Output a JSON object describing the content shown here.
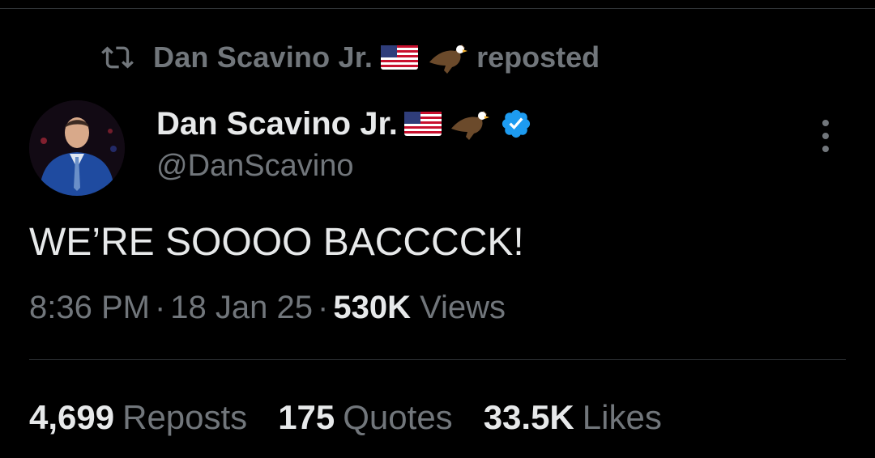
{
  "repost_banner": {
    "reposter_name": "Dan Scavino Jr.",
    "action": "reposted",
    "icon": "repost-icon"
  },
  "author": {
    "display_name": "Dan Scavino Jr.",
    "handle": "@DanScavino",
    "verified": true,
    "emoji": [
      "us-flag-icon",
      "eagle-icon"
    ]
  },
  "tweet": {
    "text": "WE’RE SOOOO BACCCCK!",
    "time": "8:36 PM",
    "date": "18 Jan 25",
    "views_count": "530K",
    "views_label": "Views"
  },
  "stats": {
    "reposts_count": "4,699",
    "reposts_label": "Reposts",
    "quotes_count": "175",
    "quotes_label": "Quotes",
    "likes_count": "33.5K",
    "likes_label": "Likes"
  },
  "colors": {
    "background": "#000000",
    "primary_text": "#e7e9ea",
    "secondary_text": "#71767b",
    "divider": "#2f3336",
    "verified_blue": "#1d9bf0"
  }
}
